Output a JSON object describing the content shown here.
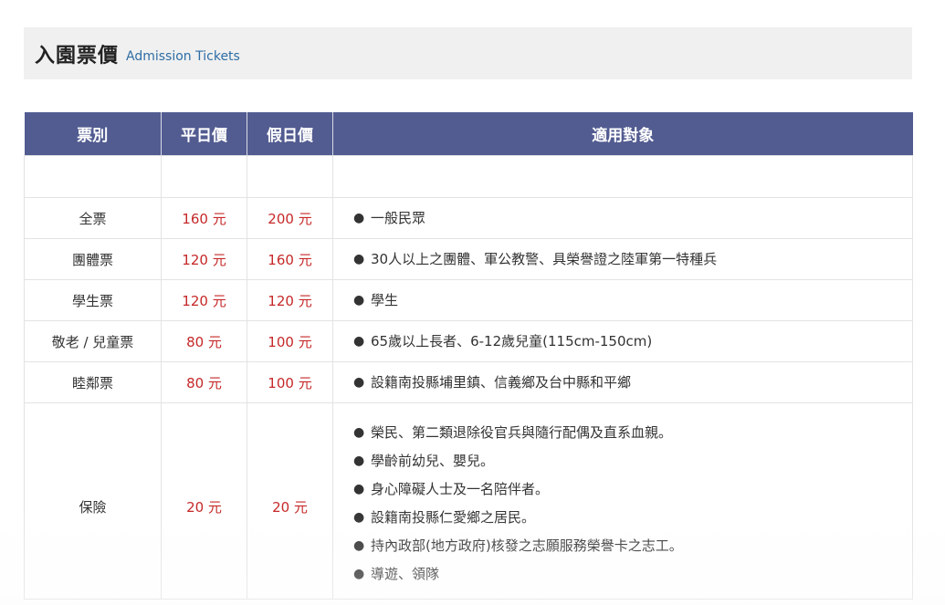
{
  "title": {
    "main": "入園票價",
    "sub": "Admission Tickets"
  },
  "table": {
    "headers": [
      "票別",
      "平日價",
      "假日價",
      "適用對象"
    ],
    "rows": [
      {
        "type": "全票",
        "weekday": "160 元",
        "holiday": "200 元",
        "targets": [
          "一般民眾"
        ]
      },
      {
        "type": "團體票",
        "weekday": "120 元",
        "holiday": "160 元",
        "targets": [
          "30人以上之團體、軍公教警、具榮譽證之陸軍第一特種兵"
        ]
      },
      {
        "type": "學生票",
        "weekday": "120 元",
        "holiday": "120 元",
        "targets": [
          "學生"
        ]
      },
      {
        "type": "敬老 / 兒童票",
        "weekday": "80 元",
        "holiday": "100 元",
        "targets": [
          "65歲以上長者、6-12歲兒童(115cm-150cm)"
        ]
      },
      {
        "type": "睦鄰票",
        "weekday": "80 元",
        "holiday": "100 元",
        "targets": [
          "設籍南投縣埔里鎮、信義鄉及台中縣和平鄉"
        ]
      },
      {
        "type": "保險",
        "weekday": "20 元",
        "holiday": "20 元",
        "targets": [
          "榮民、第二類退除役官兵與隨行配偶及直系血親。",
          "學齡前幼兒、嬰兒。",
          "身心障礙人士及一名陪伴者。",
          "設籍南投縣仁愛鄉之居民。",
          "持內政部(地方政府)核發之志願服務榮譽卡之志工。",
          "導遊、領隊"
        ]
      }
    ]
  },
  "colors": {
    "header_bg": "#525c91",
    "price_text": "#c62828",
    "title_bar_bg": "#f0f0f0",
    "subtitle_text": "#2e6da4"
  }
}
